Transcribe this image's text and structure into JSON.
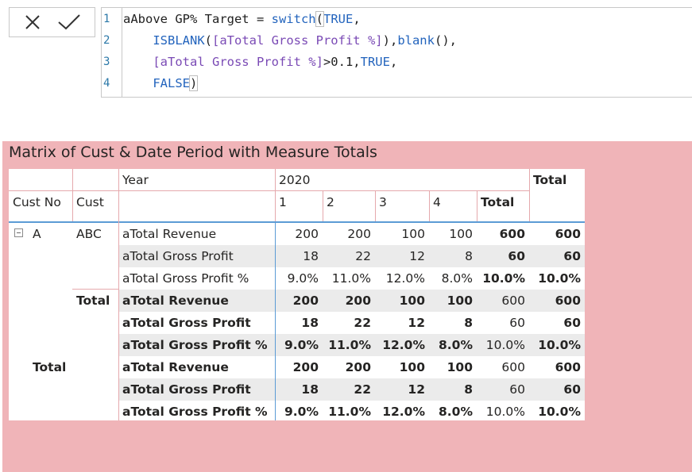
{
  "formula_bar": {
    "cancel_label": "✕",
    "commit_label": "✓",
    "lines": [
      {
        "num": "1",
        "parts": [
          {
            "t": "aAbove GP% Target = ",
            "c": ""
          },
          {
            "t": "switch",
            "c": "tok-fn"
          },
          {
            "t": "(",
            "c": "tok-br"
          },
          {
            "t": "TRUE",
            "c": "tok-kw"
          },
          {
            "t": ",",
            "c": ""
          }
        ]
      },
      {
        "num": "2",
        "parts": [
          {
            "t": "    ",
            "c": ""
          },
          {
            "t": "ISBLANK",
            "c": "tok-fn"
          },
          {
            "t": "(",
            "c": ""
          },
          {
            "t": "[aTotal Gross Profit %]",
            "c": "tok-col"
          },
          {
            "t": "),",
            "c": ""
          },
          {
            "t": "blank",
            "c": "tok-fn"
          },
          {
            "t": "(),",
            "c": ""
          }
        ]
      },
      {
        "num": "3",
        "parts": [
          {
            "t": "    ",
            "c": ""
          },
          {
            "t": "[aTotal Gross Profit %]",
            "c": "tok-col"
          },
          {
            "t": ">0.1,",
            "c": ""
          },
          {
            "t": "TRUE",
            "c": "tok-kw"
          },
          {
            "t": ",",
            "c": ""
          }
        ]
      },
      {
        "num": "4",
        "parts": [
          {
            "t": "    ",
            "c": ""
          },
          {
            "t": "FALSE",
            "c": "tok-kw"
          },
          {
            "t": ")",
            "c": "tok-br"
          }
        ]
      }
    ]
  },
  "visual": {
    "title": "Matrix of Cust & Date Period with Measure Totals",
    "background": "#f0b4b8",
    "header": {
      "year_label": "Year",
      "year_value": "2020",
      "total_label": "Total",
      "cust_no_label": "Cust No",
      "cust_label": "Cust",
      "quarters": [
        "1",
        "2",
        "3",
        "4"
      ],
      "subtotal_label": "Total"
    },
    "row_groups": {
      "cust_no": "A",
      "cust": "ABC",
      "cust_total_label": "Total",
      "grand_total_label": "Total"
    },
    "rows": [
      {
        "measure": "aTotal Revenue",
        "values": [
          "200",
          "200",
          "100",
          "100"
        ],
        "year_total": "600",
        "total": "600"
      },
      {
        "measure": "aTotal Gross Profit",
        "values": [
          "18",
          "22",
          "12",
          "8"
        ],
        "year_total": "60",
        "total": "60"
      },
      {
        "measure": "aTotal Gross Profit %",
        "values": [
          "9.0%",
          "11.0%",
          "12.0%",
          "8.0%"
        ],
        "year_total": "10.0%",
        "total": "10.0%"
      },
      {
        "measure": "aTotal Revenue",
        "values": [
          "200",
          "200",
          "100",
          "100"
        ],
        "year_total": "600",
        "total": "600"
      },
      {
        "measure": "aTotal Gross Profit",
        "values": [
          "18",
          "22",
          "12",
          "8"
        ],
        "year_total": "60",
        "total": "60"
      },
      {
        "measure": "aTotal Gross Profit %",
        "values": [
          "9.0%",
          "11.0%",
          "12.0%",
          "8.0%"
        ],
        "year_total": "10.0%",
        "total": "10.0%"
      },
      {
        "measure": "aTotal Revenue",
        "values": [
          "200",
          "200",
          "100",
          "100"
        ],
        "year_total": "600",
        "total": "600"
      },
      {
        "measure": "aTotal Gross Profit",
        "values": [
          "18",
          "22",
          "12",
          "8"
        ],
        "year_total": "60",
        "total": "60"
      },
      {
        "measure": "aTotal Gross Profit %",
        "values": [
          "9.0%",
          "11.0%",
          "12.0%",
          "8.0%"
        ],
        "year_total": "10.0%",
        "total": "10.0%"
      }
    ]
  }
}
